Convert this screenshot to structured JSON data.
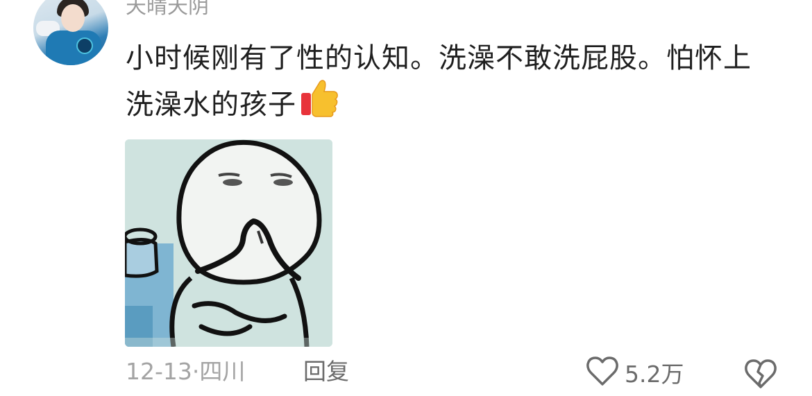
{
  "comment": {
    "username": "天晴天阴",
    "text": "小时候刚有了性的认知。洗澡不敢洗屁股。怕怀上洗澡水的孩子",
    "emoji": "thumbs-up-icon",
    "date": "12-13",
    "separator": "·",
    "location": "四川",
    "reply_label": "回复",
    "like_count": "5.2万"
  },
  "colors": {
    "text_primary": "#1f1f1f",
    "text_secondary": "#a3a3a3",
    "action_text": "#6b6b6b",
    "background": "#ffffff"
  },
  "icons": [
    "avatar",
    "thumbs-up-icon",
    "heart-icon",
    "broken-heart-icon"
  ]
}
